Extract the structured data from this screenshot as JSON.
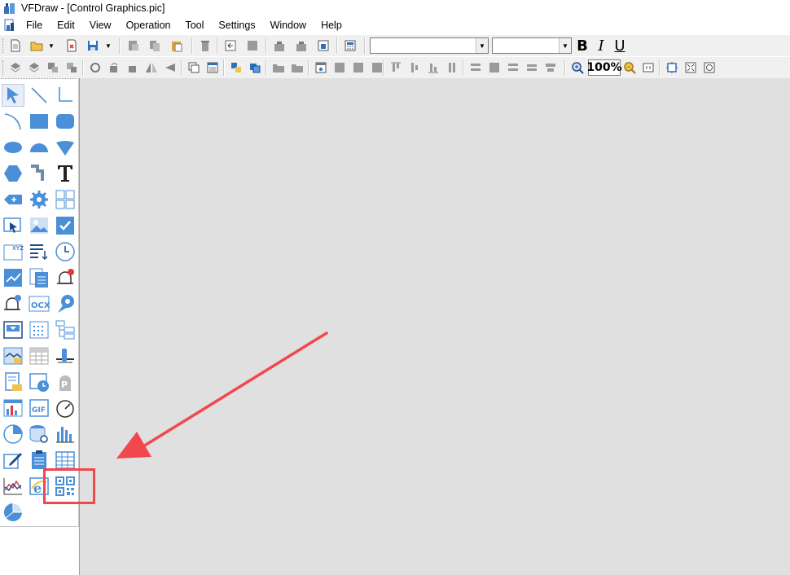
{
  "window": {
    "title": "VFDraw - [Control Graphics.pic]"
  },
  "menu": {
    "items": [
      "File",
      "Edit",
      "View",
      "Operation",
      "Tool",
      "Settings",
      "Window",
      "Help"
    ]
  },
  "toolbar": {
    "font_name": "",
    "font_size": "",
    "bold_label": "B",
    "italic_label": "I",
    "underline_label": "U",
    "zoom_value": "100%"
  },
  "palette": {
    "tools": [
      "select-arrow-icon",
      "line-icon",
      "polyline-icon",
      "arc-icon",
      "rectangle-icon",
      "rounded-rectangle-icon",
      "ellipse-icon",
      "chord-icon",
      "pie-icon",
      "polygon-icon",
      "pipe-icon",
      "text-tool-icon",
      "dynamic-text-icon",
      "gear-icon",
      "grid-block-icon",
      "button-control-icon",
      "image-icon",
      "checkbox-icon",
      "xyz-input-icon",
      "list-sort-icon",
      "clock-icon",
      "trend-chart-icon",
      "document-list-icon",
      "alarm-bell-icon",
      "alarm-config-icon",
      "ocx-control-icon",
      "fan-icon",
      "dropdown-control-icon",
      "calendar-grid-icon",
      "tree-control-icon",
      "history-curve-icon",
      "data-table-icon",
      "slider-icon",
      "report-icon",
      "schedule-icon",
      "parking-icon",
      "bar-report-icon",
      "gif-icon",
      "gauge-icon",
      "pie-chart-icon",
      "database-query-icon",
      "bar-chart-icon",
      "edit-form-icon",
      "clipboard-icon",
      "table-grid-icon",
      "line-chart-icon",
      "web-browser-icon",
      "qr-code-icon",
      "pie-3d-icon"
    ]
  },
  "colors": {
    "tool_blue": "#4a8fd8",
    "highlight_red": "#f0484d",
    "canvas_bg": "#e0e0e0"
  }
}
